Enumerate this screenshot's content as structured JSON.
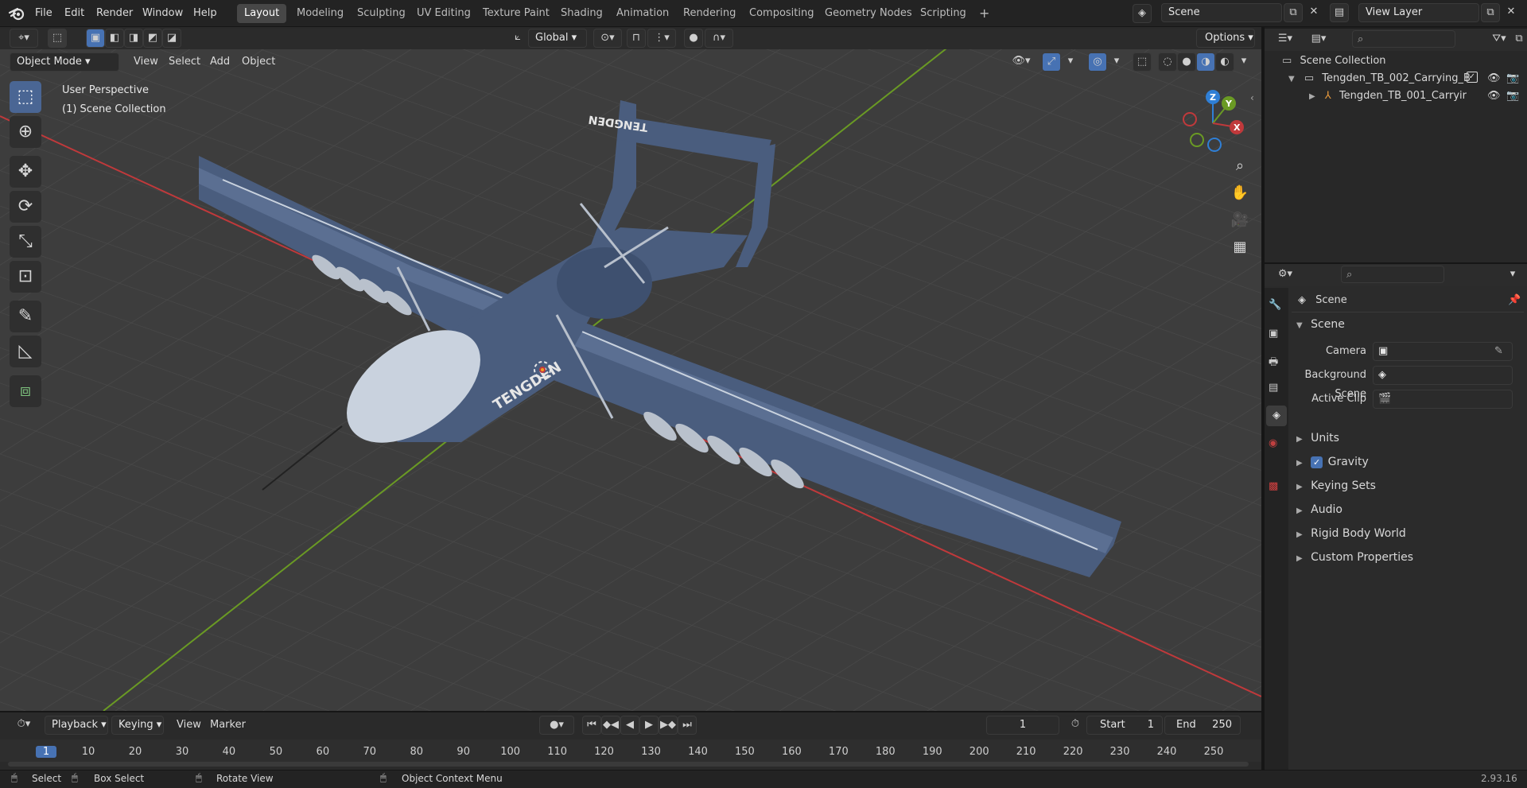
{
  "app": {
    "logo": "blender-logo-icon"
  },
  "menu": {
    "file": "File",
    "edit": "Edit",
    "render": "Render",
    "window": "Window",
    "help": "Help"
  },
  "workspaces": [
    "Layout",
    "Modeling",
    "Sculpting",
    "UV Editing",
    "Texture Paint",
    "Shading",
    "Animation",
    "Rendering",
    "Compositing",
    "Geometry Nodes",
    "Scripting"
  ],
  "active_workspace": "Layout",
  "top_right": {
    "scene": "Scene",
    "view_layer": "View Layer"
  },
  "viewport_header": {
    "mode": "Object Mode",
    "view": "View",
    "select": "Select",
    "add": "Add",
    "object": "Object",
    "transform_orientation": "Global",
    "options": "Options"
  },
  "viewport": {
    "perspective_label": "User Perspective",
    "collection_label": "(1) Scene Collection",
    "model_text": "TENGDEN",
    "axes": {
      "x": "X",
      "y": "Y",
      "z": "Z"
    }
  },
  "outliner": {
    "search_placeholder": "",
    "root": "Scene Collection",
    "items": [
      {
        "name": "Tengden_TB_002_Carrying_B"
      },
      {
        "name": "Tengden_TB_001_Carryir"
      }
    ]
  },
  "properties": {
    "context": "Scene",
    "panel": "Scene",
    "camera_label": "Camera",
    "background_scene_label": "Background Scene",
    "active_clip_label": "Active Clip",
    "sections": [
      "Units",
      "Gravity",
      "Keying Sets",
      "Audio",
      "Rigid Body World",
      "Custom Properties"
    ],
    "gravity_checked": true
  },
  "timeline": {
    "playback": "Playback",
    "keying": "Keying",
    "view": "View",
    "marker": "Marker",
    "current_frame": "1",
    "start_label": "Start",
    "start": "1",
    "end_label": "End",
    "end": "250",
    "ticks": [
      "1",
      "10",
      "20",
      "30",
      "40",
      "50",
      "60",
      "70",
      "80",
      "90",
      "100",
      "110",
      "120",
      "130",
      "140",
      "150",
      "160",
      "170",
      "180",
      "190",
      "200",
      "210",
      "220",
      "230",
      "240",
      "250"
    ]
  },
  "status": {
    "select": "Select",
    "box_select": "Box Select",
    "rotate_view": "Rotate View",
    "context_menu": "Object Context Menu",
    "version": "2.93.16"
  },
  "colors": {
    "accent": "#4772b3",
    "x_axis": "#c0393b",
    "y_axis": "#6a9a24",
    "z_axis": "#2f7fd6",
    "plane_body": "#4a5d7e",
    "canopy": "#c9d2de"
  }
}
